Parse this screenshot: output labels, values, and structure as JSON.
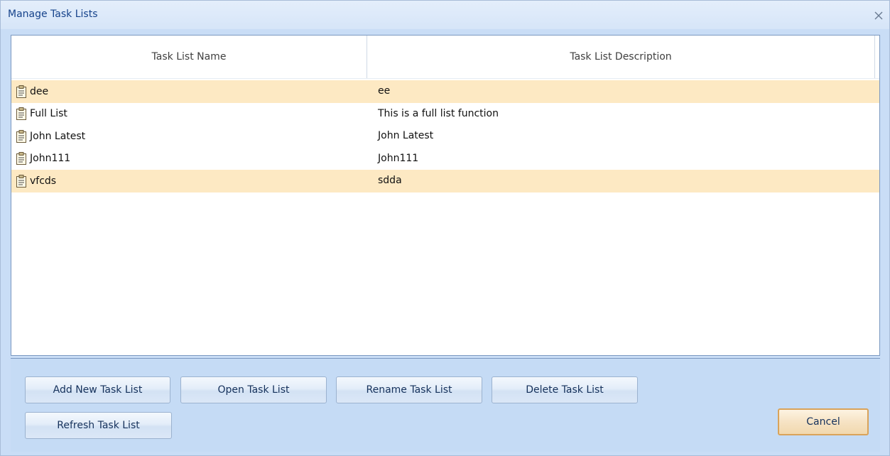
{
  "window": {
    "title": "Manage Task Lists",
    "close_glyph": "X"
  },
  "table": {
    "columns": [
      "Task List Name",
      "Task List Description"
    ],
    "rows": [
      {
        "name": "dee",
        "description": "ee",
        "highlighted": true,
        "icon": "task-list-icon"
      },
      {
        "name": "Full List",
        "description": "This is a full list function",
        "highlighted": false,
        "icon": "task-list-icon"
      },
      {
        "name": "John Latest",
        "description": "John Latest",
        "highlighted": false,
        "icon": "task-list-icon"
      },
      {
        "name": "John111",
        "description": "John111",
        "highlighted": false,
        "icon": "task-list-icon"
      },
      {
        "name": "vfcds",
        "description": "sdda",
        "highlighted": true,
        "icon": "task-list-icon"
      }
    ]
  },
  "buttons": {
    "add": "Add New Task List",
    "open": "Open Task List",
    "rename": "Rename Task List",
    "delete": "Delete Task List",
    "refresh": "Refresh Task List",
    "cancel": "Cancel"
  },
  "colors": {
    "title_text": "#15428b",
    "row_highlight": "#fde9c3",
    "panel_background": "#c5dbf5",
    "cancel_border": "#d9a35a"
  }
}
